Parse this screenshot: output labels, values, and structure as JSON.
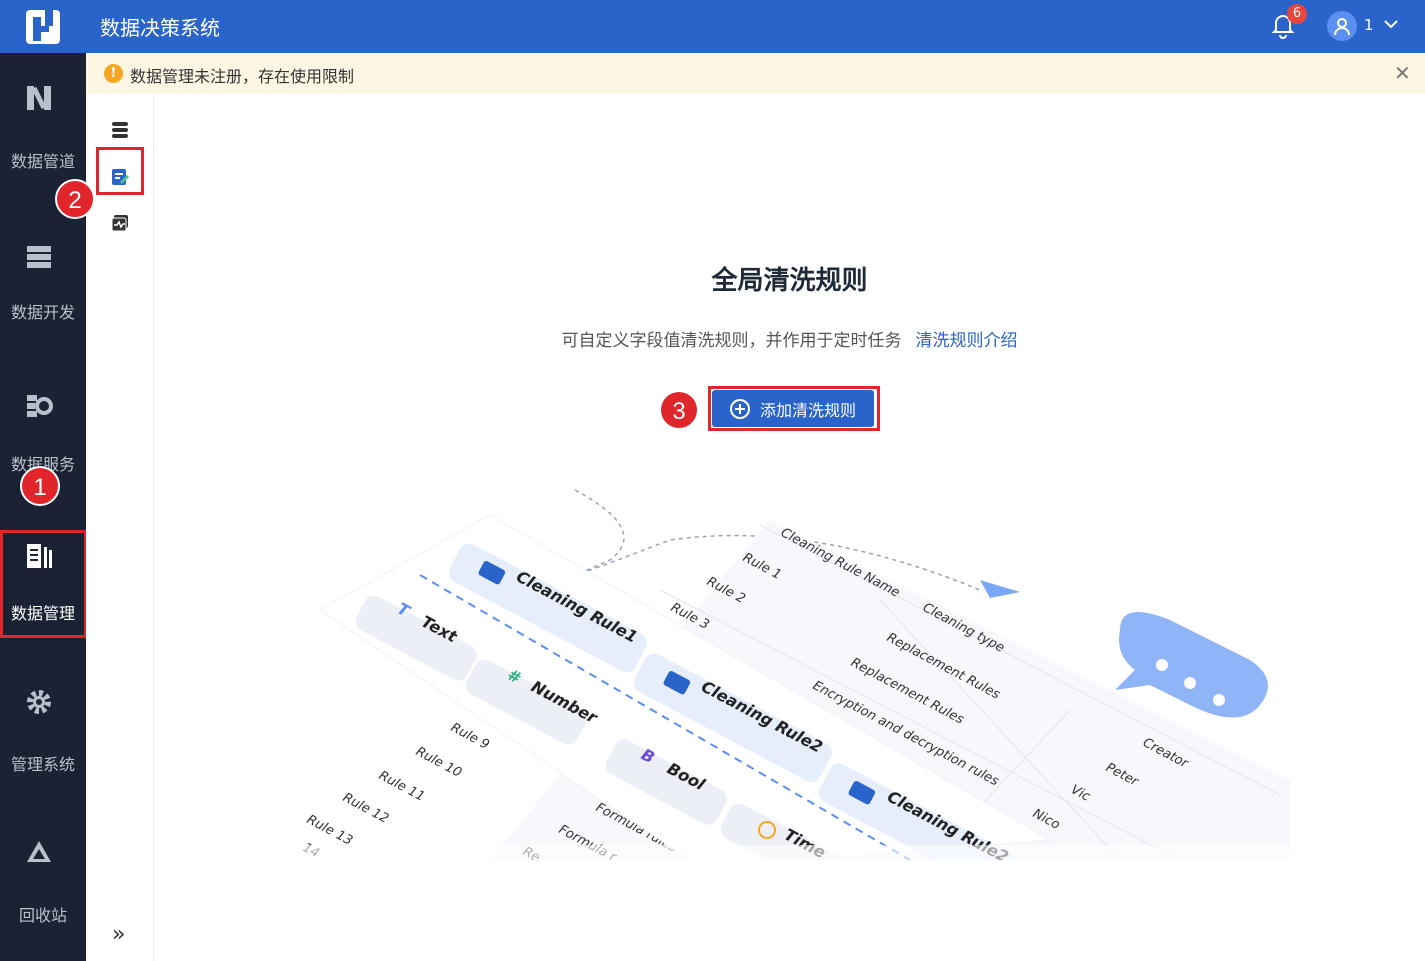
{
  "header": {
    "app_title": "数据决策系统",
    "notification_count": "6",
    "user_name": "1"
  },
  "sidebar": {
    "items": [
      {
        "label": "数据管道",
        "icon": "pipeline-icon"
      },
      {
        "label": "数据开发",
        "icon": "server-icon"
      },
      {
        "label": "数据服务",
        "icon": "service-icon"
      },
      {
        "label": "数据管理",
        "icon": "data-management-icon",
        "active": true
      },
      {
        "label": "管理系统",
        "icon": "gear-icon"
      },
      {
        "label": "回收站",
        "icon": "recycle-icon"
      }
    ]
  },
  "notice": {
    "icon": "!",
    "text": "数据管理未注册，存在使用限制"
  },
  "subbar": {
    "expand_label": "»"
  },
  "markers": [
    "1",
    "2",
    "3"
  ],
  "main": {
    "title": "全局清洗规则",
    "description": "可自定义字段值清洗规则，并作用于定时任务",
    "link": "清洗规则介绍",
    "add_button": "添加清洗规则"
  },
  "illustration": {
    "cards": [
      "Cleaning Rule1",
      "Cleaning Rule2",
      "Cleaning Rule2"
    ],
    "types": [
      "Text",
      "Number",
      "Bool",
      "Time"
    ],
    "type_glyphs": [
      "T",
      "#",
      "B"
    ],
    "table_headers": [
      "Cleaning Rule Name",
      "Cleaning type",
      "Creator"
    ],
    "rule_names": [
      "Rule 1",
      "Rule 2",
      "Rule 3"
    ],
    "cleaning_types": [
      "Replacement Rules",
      "Replacement Rules",
      "Encryption and decryption rules"
    ],
    "creators": [
      "Peter",
      "Vic",
      "Nico"
    ],
    "lower_rules": [
      "Rule 9",
      "Rule 10",
      "Rule 11",
      "Rule 12",
      "Rule 13",
      "14"
    ],
    "lower_types": [
      "Formula rules",
      "Formula r",
      "Re"
    ]
  },
  "colors": {
    "primary": "#2a63c9",
    "sidebar_bg": "#1a2233",
    "marker_red": "#e0262b",
    "notice_bg": "#fdf6e3"
  }
}
